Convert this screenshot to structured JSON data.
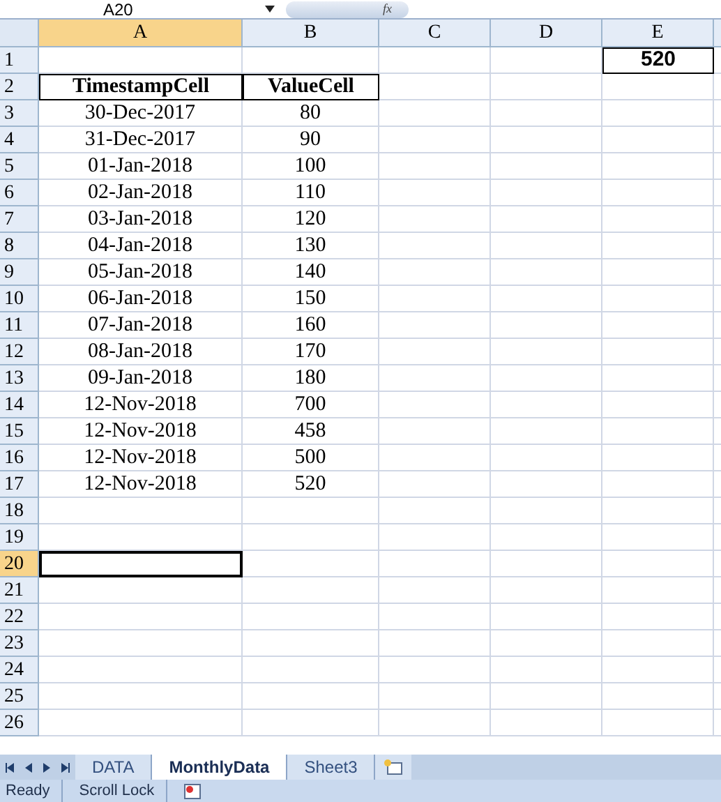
{
  "name_box": "A20",
  "formula_icon": "fx",
  "columns": [
    {
      "label": "A",
      "selected": true
    },
    {
      "label": "B",
      "selected": false
    },
    {
      "label": "C",
      "selected": false
    },
    {
      "label": "D",
      "selected": false
    },
    {
      "label": "E",
      "selected": false
    }
  ],
  "rows": [
    {
      "number": "1",
      "selected": false,
      "kind": "result",
      "cells": [
        null,
        null,
        null,
        null,
        "520"
      ]
    },
    {
      "number": "2",
      "selected": false,
      "kind": "header",
      "cells": [
        "TimestampCell",
        "ValueCell"
      ]
    },
    {
      "number": "3",
      "selected": false,
      "kind": "data",
      "cells": [
        "30-Dec-2017",
        "80"
      ]
    },
    {
      "number": "4",
      "selected": false,
      "kind": "data",
      "cells": [
        "31-Dec-2017",
        "90"
      ]
    },
    {
      "number": "5",
      "selected": false,
      "kind": "data",
      "cells": [
        "01-Jan-2018",
        "100"
      ]
    },
    {
      "number": "6",
      "selected": false,
      "kind": "data",
      "cells": [
        "02-Jan-2018",
        "110"
      ]
    },
    {
      "number": "7",
      "selected": false,
      "kind": "data",
      "cells": [
        "03-Jan-2018",
        "120"
      ]
    },
    {
      "number": "8",
      "selected": false,
      "kind": "data",
      "cells": [
        "04-Jan-2018",
        "130"
      ]
    },
    {
      "number": "9",
      "selected": false,
      "kind": "data",
      "cells": [
        "05-Jan-2018",
        "140"
      ]
    },
    {
      "number": "10",
      "selected": false,
      "kind": "data",
      "cells": [
        "06-Jan-2018",
        "150"
      ]
    },
    {
      "number": "11",
      "selected": false,
      "kind": "data",
      "cells": [
        "07-Jan-2018",
        "160"
      ]
    },
    {
      "number": "12",
      "selected": false,
      "kind": "data",
      "cells": [
        "08-Jan-2018",
        "170"
      ]
    },
    {
      "number": "13",
      "selected": false,
      "kind": "data",
      "cells": [
        "09-Jan-2018",
        "180"
      ]
    },
    {
      "number": "14",
      "selected": false,
      "kind": "data",
      "cells": [
        "12-Nov-2018",
        "700"
      ]
    },
    {
      "number": "15",
      "selected": false,
      "kind": "data",
      "cells": [
        "12-Nov-2018",
        "458"
      ]
    },
    {
      "number": "16",
      "selected": false,
      "kind": "data",
      "cells": [
        "12-Nov-2018",
        "500"
      ]
    },
    {
      "number": "17",
      "selected": false,
      "kind": "data",
      "cells": [
        "12-Nov-2018",
        "520"
      ]
    },
    {
      "number": "18",
      "selected": false
    },
    {
      "number": "19",
      "selected": false
    },
    {
      "number": "20",
      "selected": true
    },
    {
      "number": "21",
      "selected": false
    },
    {
      "number": "22",
      "selected": false
    },
    {
      "number": "23",
      "selected": false
    },
    {
      "number": "24",
      "selected": false
    },
    {
      "number": "25",
      "selected": false
    },
    {
      "number": "26",
      "selected": false
    }
  ],
  "sheet_tabs": [
    {
      "label": "DATA",
      "selected": false
    },
    {
      "label": "MonthlyData",
      "selected": true
    },
    {
      "label": "Sheet3",
      "selected": false
    }
  ],
  "status_bar": [
    "Ready",
    "Scroll Lock"
  ]
}
